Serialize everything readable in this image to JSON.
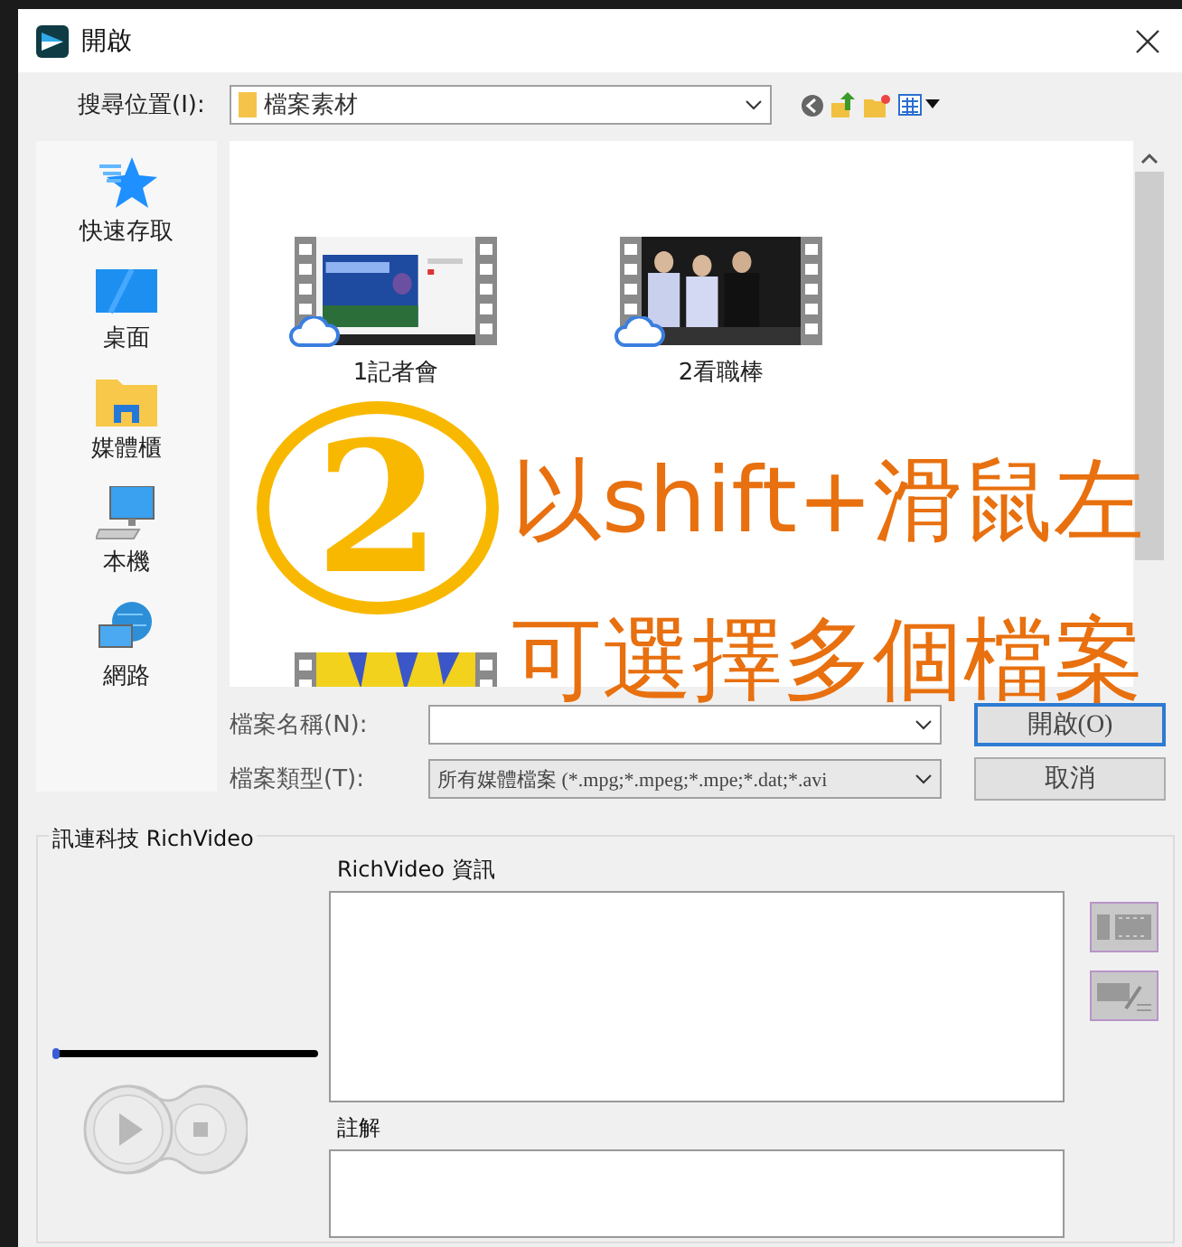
{
  "window": {
    "title": "開啟"
  },
  "look_in": {
    "label": "搜尋位置(I):",
    "value": "檔案素材"
  },
  "sidebar": {
    "items": [
      {
        "kind": "quick",
        "label": "快速存取"
      },
      {
        "kind": "desktop",
        "label": "桌面"
      },
      {
        "kind": "library",
        "label": "媒體櫃"
      },
      {
        "kind": "computer",
        "label": "本機"
      },
      {
        "kind": "network",
        "label": "網路"
      }
    ]
  },
  "files": [
    {
      "name": "1記者會",
      "cloud": true
    },
    {
      "name": "2看職棒",
      "cloud": true
    },
    {
      "cloud": false
    }
  ],
  "file_name": {
    "label": "檔案名稱(N):"
  },
  "file_type": {
    "label": "檔案類型(T):",
    "value": "所有媒體檔案 (*.mpg;*.mpeg;*.mpe;*.dat;*.avi"
  },
  "buttons": [
    {
      "label": "開啟(O)",
      "default": true
    },
    {
      "label": "取消",
      "default": false
    }
  ],
  "preview": {
    "title": "訊連科技 RichVideo",
    "slider": {
      "level": 0
    },
    "info_label": "RichVideo 資訊",
    "notes_label": "註解"
  },
  "annotation": {
    "number": "2",
    "lines": [
      "以shift+滑鼠左",
      "可選擇多個檔案"
    ]
  }
}
